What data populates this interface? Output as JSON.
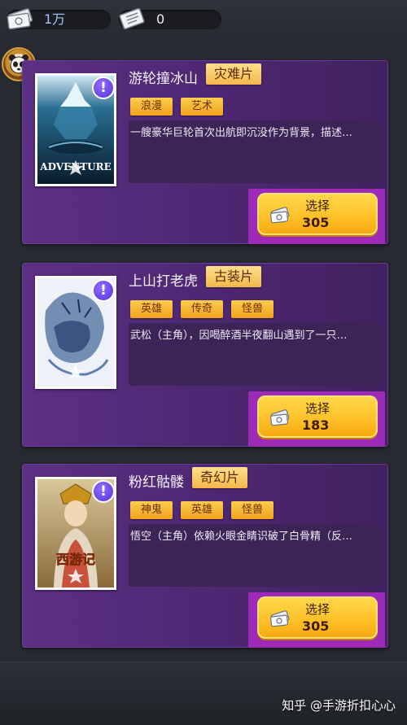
{
  "header": {
    "money_value": "1万",
    "ticket_value": "0"
  },
  "cards": [
    {
      "title": "游轮撞冰山",
      "genre": "灾难片",
      "tags": [
        "浪漫",
        "艺术"
      ],
      "description": "一艘豪华巨轮首次出航即沉没作为背景，描述…",
      "button_label": "选择",
      "price": "305",
      "poster_text": "ADVENTURE"
    },
    {
      "title": "上山打老虎",
      "genre": "古装片",
      "tags": [
        "英雄",
        "传奇",
        "怪兽"
      ],
      "description": "武松（主角），因喝醉酒半夜翻山遇到了一只…",
      "button_label": "选择",
      "price": "183"
    },
    {
      "title": "粉红骷髅",
      "genre": "奇幻片",
      "tags": [
        "神鬼",
        "英雄",
        "怪兽"
      ],
      "description": "悟空（主角）依赖火眼金睛识破了白骨精（反…",
      "button_label": "选择",
      "price": "305",
      "poster_text": "西游记"
    }
  ],
  "footer": {
    "watermark": "知乎 @手游折扣心心"
  },
  "colors": {
    "card_purple": "#5d2f85",
    "tag_yellow": "#ffcc50",
    "button_yellow": "#ffc12a",
    "alert_purple": "#6a45e6"
  }
}
